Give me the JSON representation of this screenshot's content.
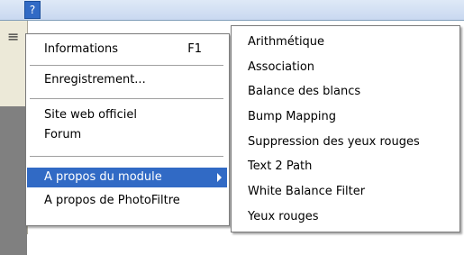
{
  "menubar": {
    "help_label": "?"
  },
  "menu": {
    "items": [
      {
        "label": "Informations",
        "shortcut": "F1"
      },
      {
        "label": "Enregistrement..."
      },
      {
        "label": "Site web officiel"
      },
      {
        "label": "Forum"
      },
      {
        "label": "A propos du module"
      },
      {
        "label": "A propos de PhotoFiltre"
      }
    ]
  },
  "submenu": {
    "items": [
      "Arithmétique",
      "Association",
      "Balance des blancs",
      "Bump Mapping",
      "Suppression des yeux rouges",
      "Text 2 Path",
      "White Balance Filter",
      "Yeux rouges"
    ]
  },
  "colors": {
    "highlight": "#316ac5",
    "menubar": "#dfe9f7"
  }
}
